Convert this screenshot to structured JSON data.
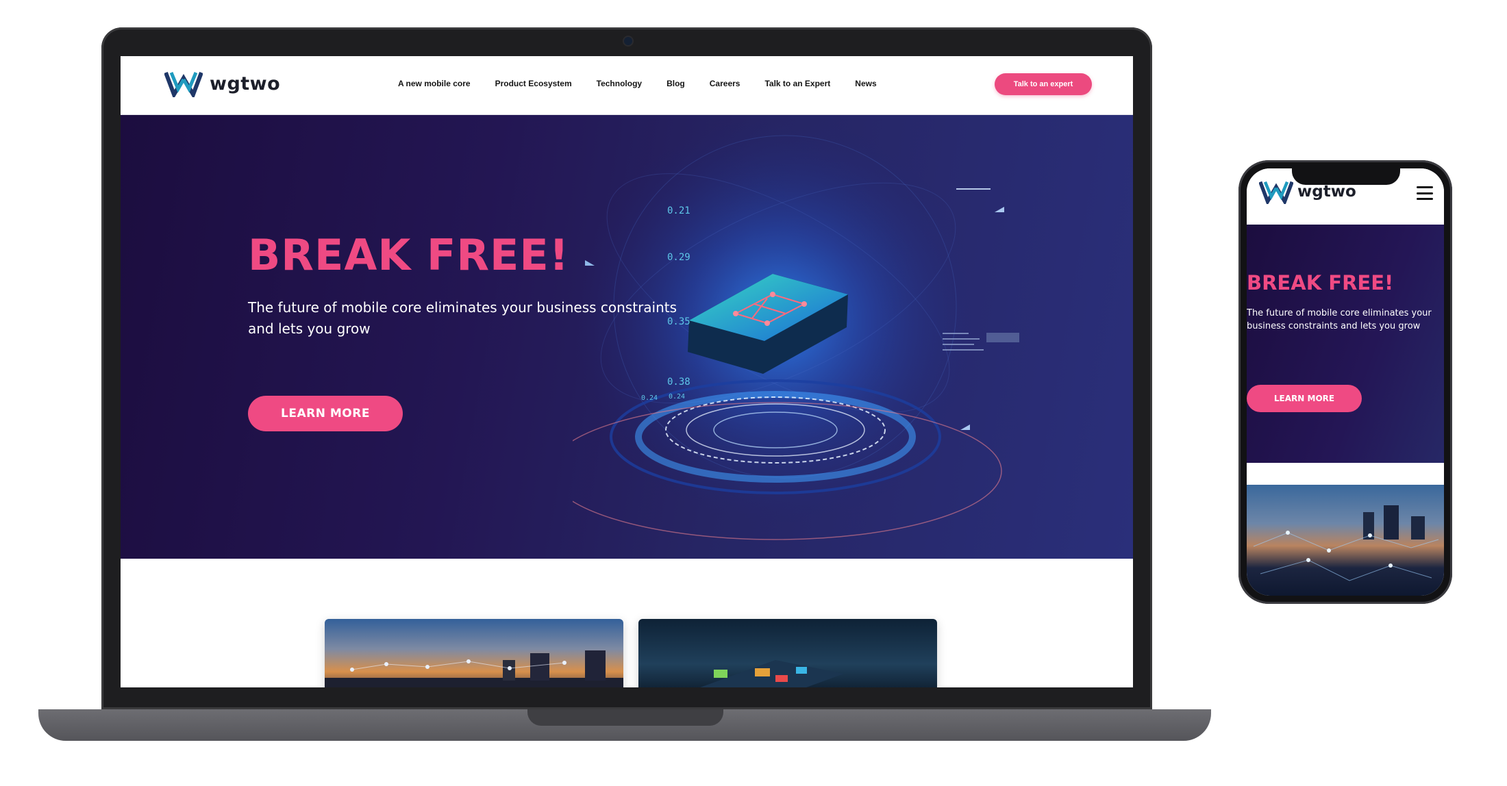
{
  "brand": {
    "name": "wgtwo"
  },
  "nav": {
    "links": [
      "A new mobile core",
      "Product Ecosystem",
      "Technology",
      "Blog",
      "Careers",
      "Talk to an Expert",
      "News"
    ],
    "cta_label": "Talk to an expert"
  },
  "hero": {
    "title": "BREAK FREE!",
    "subtitle": "The future of mobile core eliminates your business constraints and lets you grow",
    "button_label": "LEARN MORE",
    "art_numbers": [
      "0.21",
      "0.29",
      "0.35",
      "0.38",
      "0.24",
      "0.24"
    ]
  },
  "mobile": {
    "title": "BREAK FREE!",
    "subtitle": "The future of mobile core eliminates your business constraints and lets you grow",
    "button_label": "LEARN MORE"
  },
  "colors": {
    "accent": "#ef4a83",
    "hero_bg": "#231653",
    "logo_teal": "#1f9bbf",
    "logo_navy": "#1f3768"
  },
  "icons": {
    "menu": "hamburger-menu-icon",
    "logo": "wgtwo-logo-mark-icon"
  }
}
